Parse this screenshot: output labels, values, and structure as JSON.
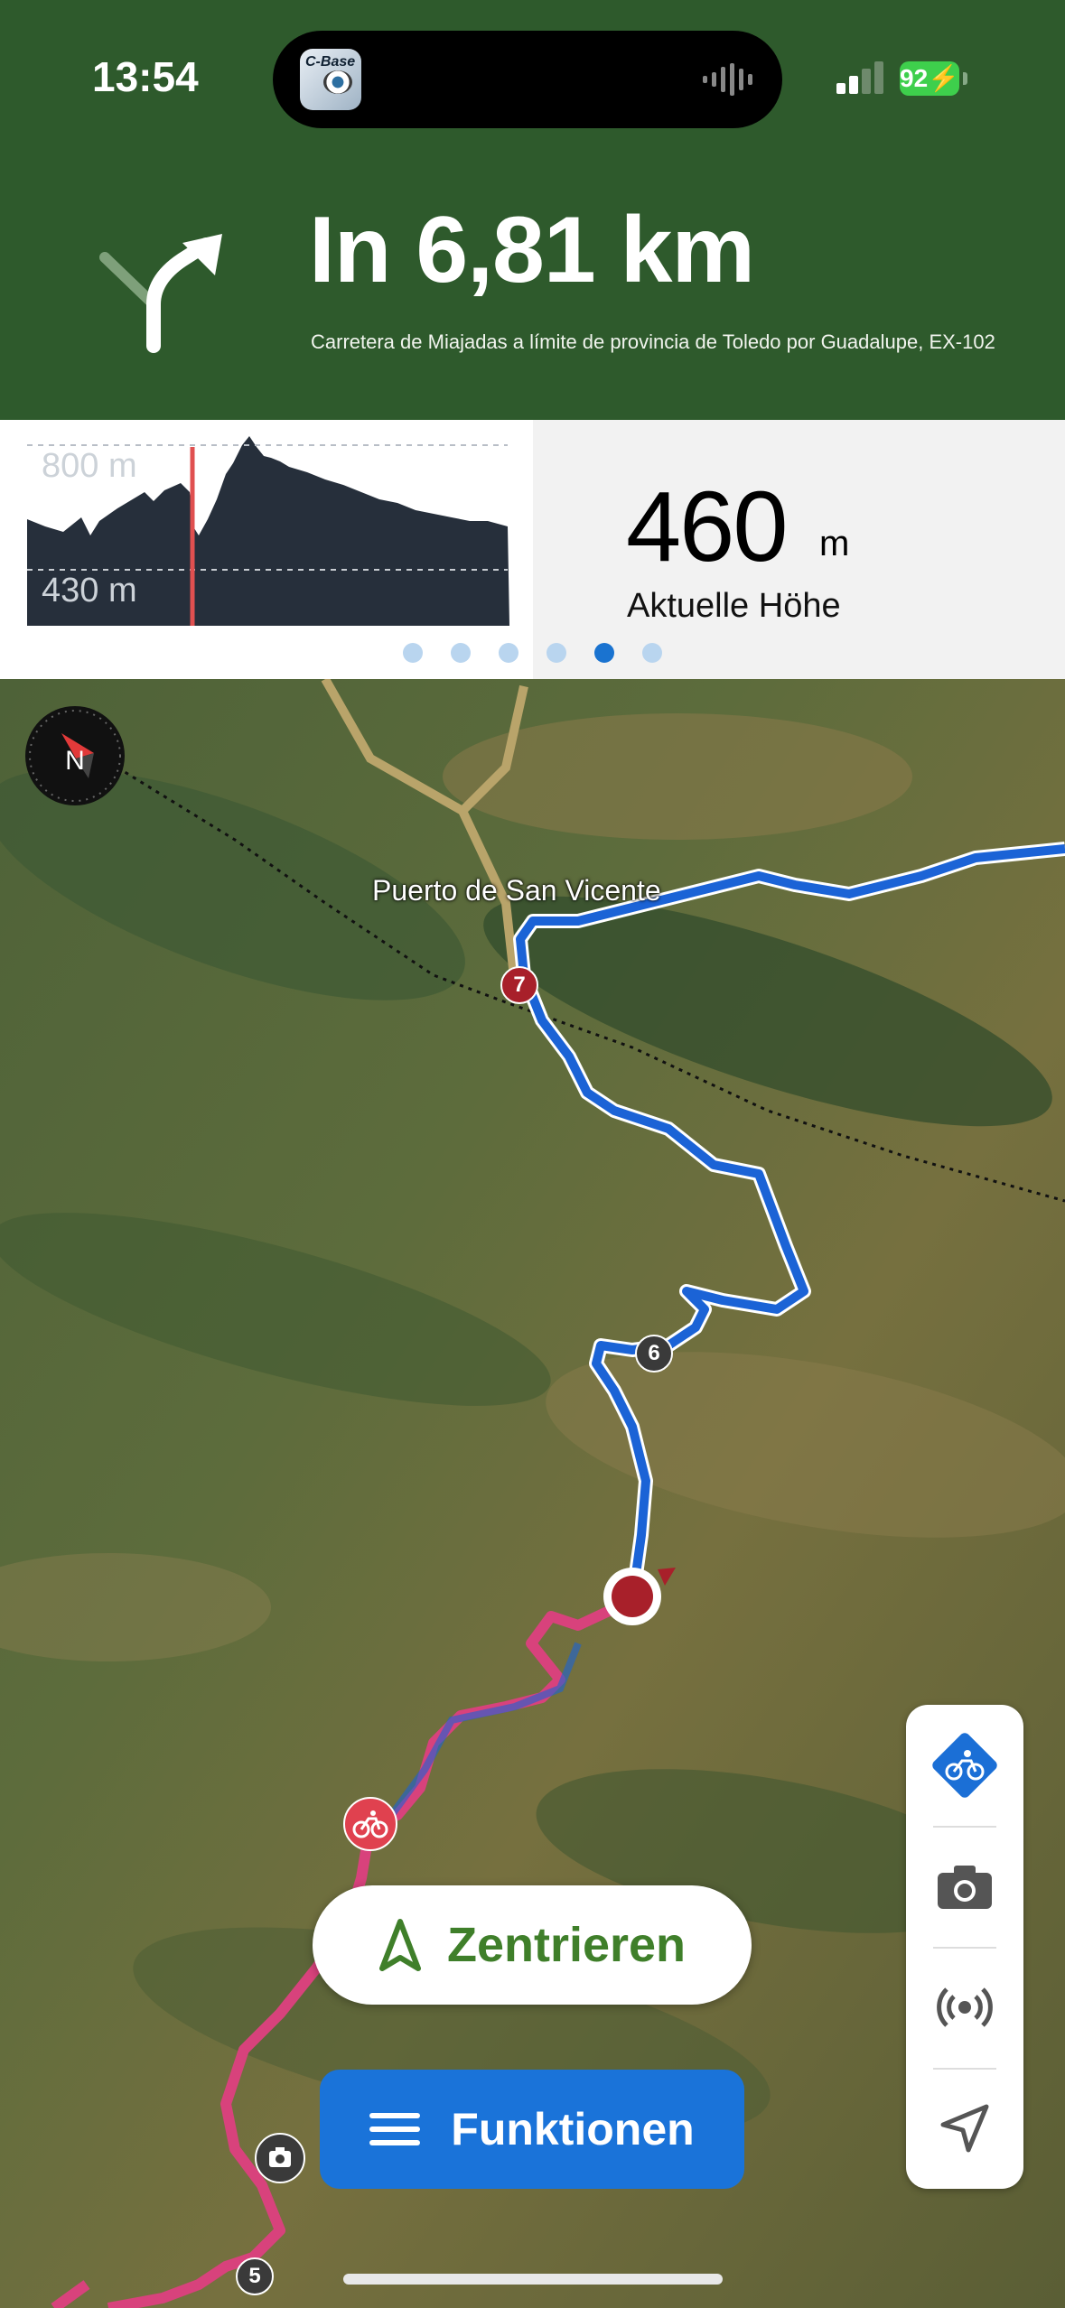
{
  "status_bar": {
    "time": "13:54",
    "battery": "92",
    "island_app_name": "C-Base"
  },
  "navigation": {
    "distance": "In 6,81 km",
    "road": "Carretera de Miajadas a límite de provincia de Toledo por Guadalupe, EX-102",
    "turn_icon": "turn-right-arrow-icon"
  },
  "elevation": {
    "max_label": "800 m",
    "min_label": "430 m",
    "current_altitude": "460",
    "altitude_unit": "m",
    "altitude_label": "Aktuelle Höhe",
    "page_count": 6,
    "active_page": 5
  },
  "map": {
    "place_name": "Puerto de San Vicente",
    "waypoints": [
      {
        "label": "7",
        "color": "#a8202a"
      },
      {
        "label": "6",
        "color": "#3a3a3a"
      },
      {
        "label": "5",
        "color": "#3a3a3a"
      }
    ],
    "route_color_ahead": "#1b63d6",
    "route_color_done": "#d8427c"
  },
  "sidebar": {
    "items": [
      {
        "icon": "bicycle-icon"
      },
      {
        "icon": "camera-icon"
      },
      {
        "icon": "broadcast-icon"
      },
      {
        "icon": "location-arrow-icon"
      }
    ]
  },
  "buttons": {
    "center_label": "Zentrieren",
    "functions_label": "Funktionen"
  }
}
